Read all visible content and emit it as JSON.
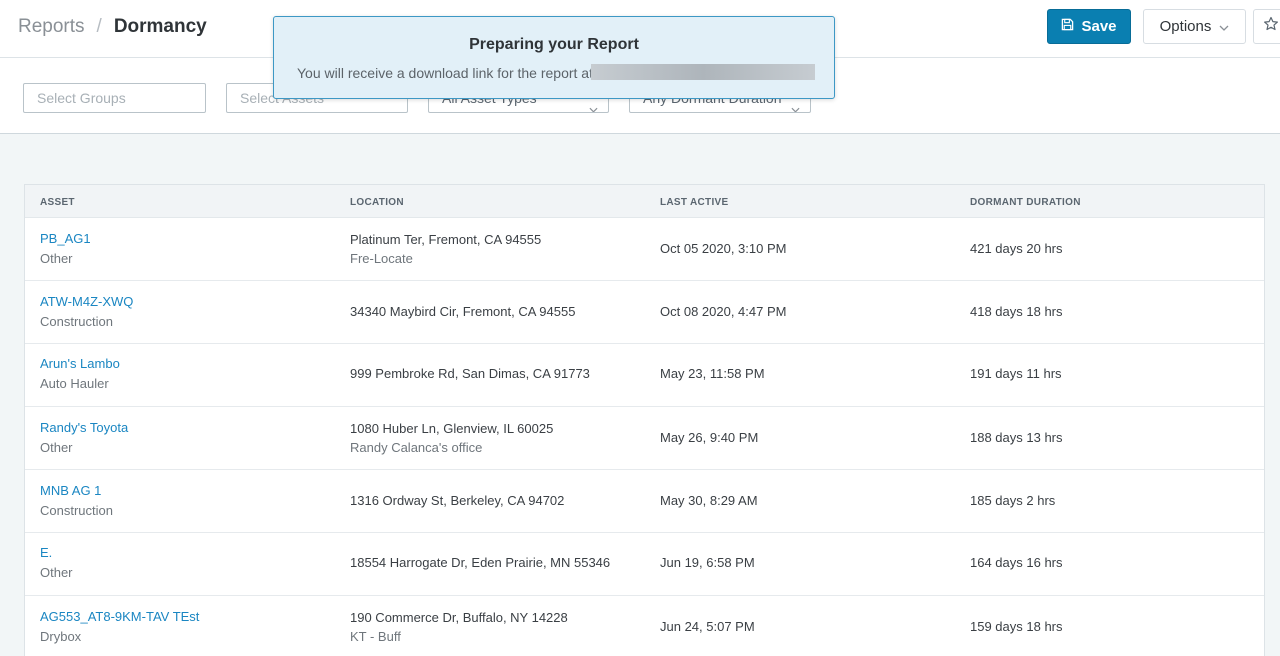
{
  "breadcrumb": {
    "parent": "Reports",
    "separator": "/",
    "current": "Dormancy"
  },
  "toolbar": {
    "save_label": "Save",
    "options_label": "Options"
  },
  "filters": {
    "groups": "Select Groups",
    "assets": "Select Assets",
    "asset_types": "All Asset Types",
    "dormant_duration": "Any Dormant Duration"
  },
  "toast": {
    "title": "Preparing your Report",
    "message": "You will receive a download link for the report at"
  },
  "table": {
    "columns": [
      "ASSET",
      "LOCATION",
      "LAST ACTIVE",
      "DORMANT DURATION"
    ],
    "rows": [
      {
        "asset": "PB_AG1",
        "type": "Other",
        "location": "Platinum Ter, Fremont, CA 94555",
        "location_sub": "Fre-Locate",
        "last_active": "Oct 05 2020, 3:10 PM",
        "dormant": "421 days 20 hrs"
      },
      {
        "asset": "ATW-M4Z-XWQ",
        "type": "Construction",
        "location": "34340 Maybird Cir, Fremont, CA 94555",
        "location_sub": "",
        "last_active": "Oct 08 2020, 4:47 PM",
        "dormant": "418 days 18 hrs"
      },
      {
        "asset": "Arun's Lambo",
        "type": "Auto Hauler",
        "location": "999 Pembroke Rd, San Dimas, CA 91773",
        "location_sub": "",
        "last_active": "May 23, 11:58 PM",
        "dormant": "191 days 11 hrs"
      },
      {
        "asset": "Randy's Toyota",
        "type": "Other",
        "location": "1080 Huber Ln, Glenview, IL 60025",
        "location_sub": "Randy Calanca's office",
        "last_active": "May 26, 9:40 PM",
        "dormant": "188 days 13 hrs"
      },
      {
        "asset": "MNB AG 1",
        "type": "Construction",
        "location": "1316 Ordway St, Berkeley, CA 94702",
        "location_sub": "",
        "last_active": "May 30, 8:29 AM",
        "dormant": "185 days 2 hrs"
      },
      {
        "asset": "E.",
        "type": "Other",
        "location": "18554 Harrogate Dr, Eden Prairie, MN 55346",
        "location_sub": "",
        "last_active": "Jun 19, 6:58 PM",
        "dormant": "164 days 16 hrs"
      },
      {
        "asset": "AG553_AT8-9KM-TAV TEst",
        "type": "Drybox",
        "location": "190 Commerce Dr, Buffalo, NY 14228",
        "location_sub": "KT - Buff",
        "last_active": "Jun 24, 5:07 PM",
        "dormant": "159 days 18 hrs"
      }
    ]
  },
  "icons": {
    "save": "floppy-disk-icon",
    "options_caret": "chevron-down-icon",
    "star": "star-icon"
  },
  "colors": {
    "accent": "#0a7fb1",
    "link": "#1a86c2",
    "toast_bg": "#e2f0f8",
    "toast_border": "#3d98c5"
  }
}
